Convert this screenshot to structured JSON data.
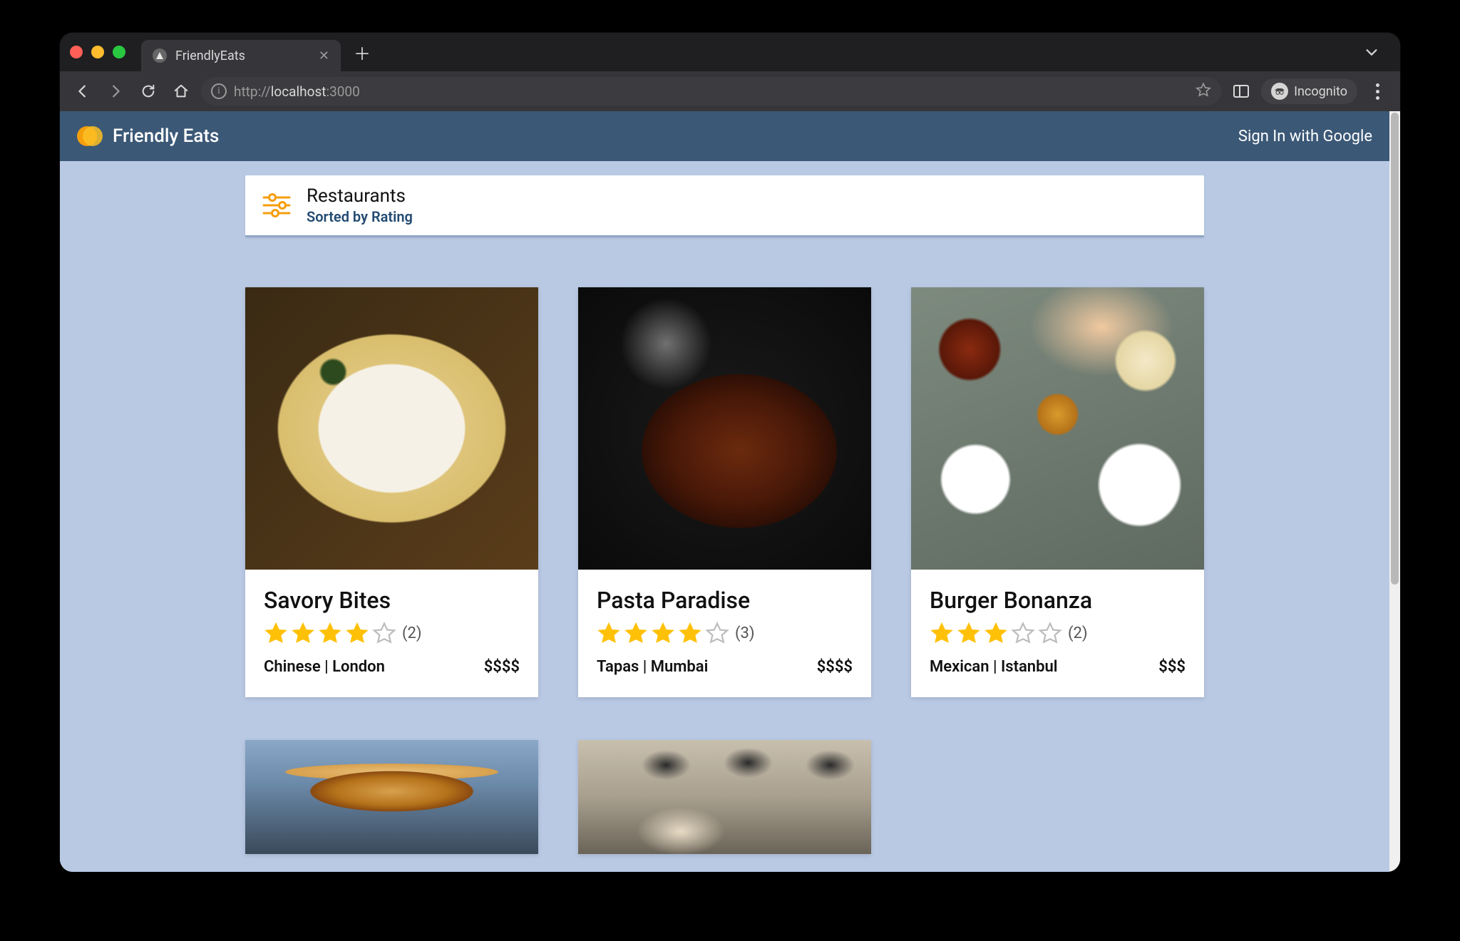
{
  "browser": {
    "tab_title": "FriendlyEats",
    "url_proto": "http://",
    "url_host": "localhost",
    "url_port": ":3000",
    "incognito_label": "Incognito"
  },
  "header": {
    "app_name": "Friendly Eats",
    "signin_label": "Sign In with Google"
  },
  "filter": {
    "title": "Restaurants",
    "subtitle": "Sorted by Rating"
  },
  "restaurants": [
    {
      "name": "Savory Bites",
      "rating": 4,
      "reviews": "(2)",
      "meta": "Chinese | London",
      "price": "$$$$",
      "img": "img1"
    },
    {
      "name": "Pasta Paradise",
      "rating": 4,
      "reviews": "(3)",
      "meta": "Tapas | Mumbai",
      "price": "$$$$",
      "img": "img2"
    },
    {
      "name": "Burger Bonanza",
      "rating": 3,
      "reviews": "(2)",
      "meta": "Mexican | Istanbul",
      "price": "$$$",
      "img": "img3"
    },
    {
      "name": "",
      "rating": 0,
      "reviews": "",
      "meta": "",
      "price": "",
      "img": "img4",
      "stub": true
    },
    {
      "name": "",
      "rating": 0,
      "reviews": "",
      "meta": "",
      "price": "",
      "img": "img5",
      "stub": true
    }
  ]
}
